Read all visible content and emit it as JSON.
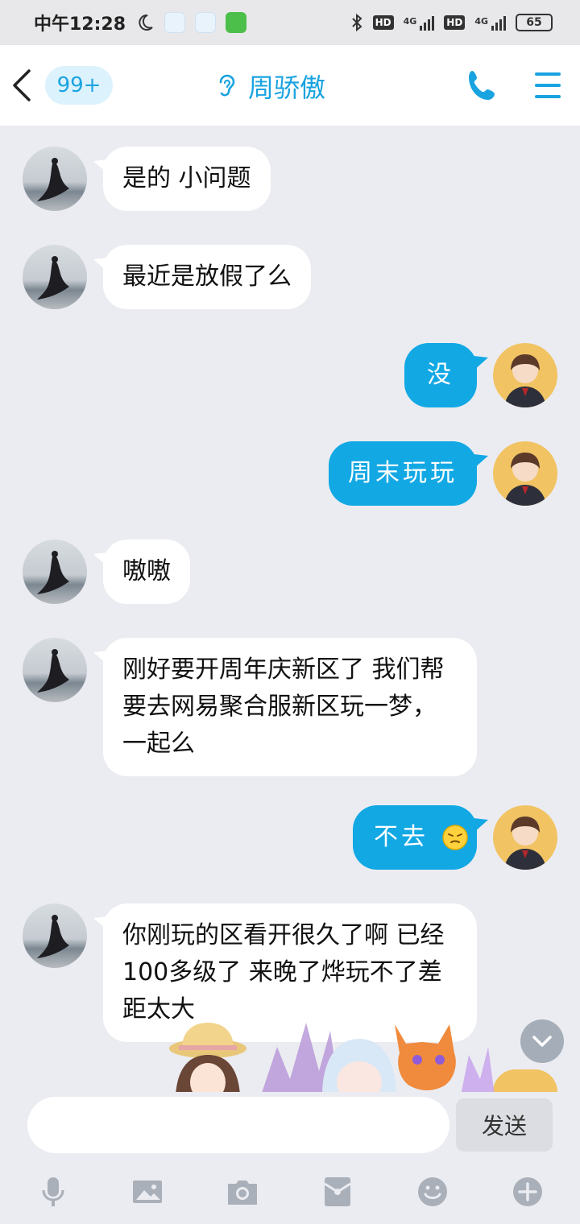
{
  "status_bar": {
    "time": "中午12:28",
    "network_left": "4G",
    "network_right": "4G",
    "hd_label": "HD",
    "battery": "65"
  },
  "header": {
    "unread_badge": "99+",
    "contact_name": "周骄傲"
  },
  "messages": [
    {
      "side": "in",
      "text": "是的 小问题"
    },
    {
      "side": "in",
      "text": "最近是放假了么"
    },
    {
      "side": "out",
      "text": "没"
    },
    {
      "side": "out",
      "text": "周末玩玩"
    },
    {
      "side": "in",
      "text": "嗷嗷"
    },
    {
      "side": "in",
      "text": "刚好要开周年庆新区了  我们帮要去网易聚合服新区玩一梦，一起么"
    },
    {
      "side": "out",
      "text": "不去"
    },
    {
      "side": "in",
      "text": "你刚玩的区看开很久了啊 已经100多级了 来晚了烨玩不了差距太大"
    }
  ],
  "composer": {
    "input_value": "",
    "send_label": "发送"
  },
  "toolbar_icons": [
    "microphone-icon",
    "image-icon",
    "camera-icon",
    "red-packet-icon",
    "emoji-icon",
    "plus-icon"
  ],
  "colors": {
    "accent": "#12a8e4",
    "background": "#ebecf1"
  }
}
